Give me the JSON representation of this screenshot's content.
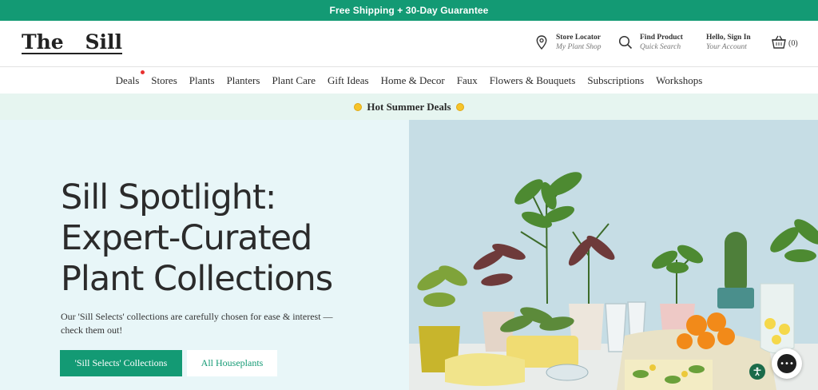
{
  "topbar": {
    "text": "Free Shipping + 30-Day Guarantee"
  },
  "logo": {
    "word1": "The",
    "word2": "Sill"
  },
  "header": {
    "store_locator": {
      "title": "Store Locator",
      "sub": "My Plant Shop",
      "icon": "map-pin-icon"
    },
    "find_product": {
      "title": "Find Product",
      "sub": "Quick Search",
      "icon": "search-icon"
    },
    "account": {
      "title": "Hello, Sign In",
      "sub": "Your Account"
    },
    "cart": {
      "count": "(0)",
      "icon": "basket-icon"
    }
  },
  "nav": [
    "Deals",
    "Stores",
    "Plants",
    "Planters",
    "Plant Care",
    "Gift Ideas",
    "Home & Decor",
    "Faux",
    "Flowers & Bouquets",
    "Subscriptions",
    "Workshops"
  ],
  "promo": {
    "text": "Hot Summer Deals"
  },
  "hero": {
    "title_lines": [
      "Sill Spotlight:",
      "Expert-Curated",
      "Plant Collections"
    ],
    "description": "Our 'Sill Selects' collections are carefully chosen for ease & interest — check them out!",
    "primary_button": "'Sill Selects' Collections",
    "secondary_button": "All Houseplants"
  },
  "colors": {
    "brand": "#139a74",
    "promo_bg": "#e6f5f0",
    "hero_bg": "#e8f6f8",
    "deal_dot": "#e8302f"
  }
}
